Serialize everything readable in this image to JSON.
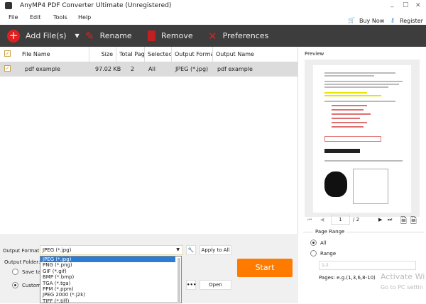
{
  "window": {
    "title": "AnyMP4 PDF Converter Ultimate (Unregistered)",
    "minimize": "_",
    "maximize": "□",
    "close": "✕"
  },
  "menu": [
    "File",
    "Edit",
    "Tools",
    "Help"
  ],
  "top_links": {
    "buy_now": "Buy Now",
    "register": "Register"
  },
  "toolbar": {
    "add_files": "Add File(s)",
    "rename": "Rename",
    "remove": "Remove",
    "preferences": "Preferences"
  },
  "table": {
    "headers": [
      "File Name",
      "Size",
      "Total Pag",
      "Selected",
      "Output Forma",
      "Output Name"
    ],
    "rows": [
      {
        "checked": true,
        "file_name": "pdf example",
        "size": "97.02 KB",
        "total_pages": "2",
        "selected": "All",
        "output_format": "JPEG (*.jpg)",
        "output_name": "pdf example"
      }
    ]
  },
  "output": {
    "format_label": "Output Format:",
    "format_value": "JPEG (*.jpg)",
    "apply_all": "Apply to All",
    "folder_label": "Output Folder:",
    "save_target": "Save ta",
    "customize": "Customi",
    "open": "Open",
    "browse": "•••",
    "start": "Start",
    "options": [
      "JPEG (*.jpg)",
      "PNG (*.png)",
      "GIF (*.gif)",
      "BMP (*.bmp)",
      "TGA (*.tga)",
      "PPM (*.ppm)",
      "JPEG 2000 (*.j2k)",
      "TIFF (*.tiff)"
    ]
  },
  "preview": {
    "label": "Preview",
    "page": "1",
    "total": "/ 2"
  },
  "page_range": {
    "title": "Page Range",
    "all": "All",
    "range": "Range",
    "range_value": "1-2",
    "hint": "Pages: e.g.(1,3,6,8-10)"
  },
  "watermark": {
    "line1": "Activate Wi",
    "line2": "Go to PC settin"
  },
  "colors": {
    "toolbar": "#3d3d3d",
    "accent_red": "#e02020",
    "start": "#ff7b00",
    "selected_option": "#2b7cd3"
  }
}
